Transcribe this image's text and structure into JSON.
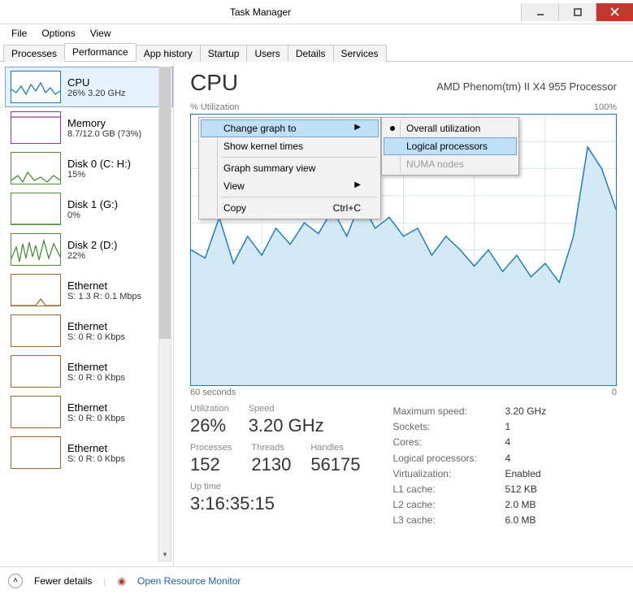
{
  "window": {
    "title": "Task Manager"
  },
  "menu": {
    "file": "File",
    "options": "Options",
    "view": "View"
  },
  "tabs": {
    "items": [
      "Processes",
      "Performance",
      "App history",
      "Startup",
      "Users",
      "Details",
      "Services"
    ],
    "active_index": 1
  },
  "sidebar": {
    "items": [
      {
        "name": "CPU",
        "sub": "26%  3.20 GHz",
        "color": "#1a7ac0"
      },
      {
        "name": "Memory",
        "sub": "8.7/12.0 GB (73%)",
        "color": "#8e3a8e"
      },
      {
        "name": "Disk 0 (C: H:)",
        "sub": "15%",
        "color": "#4e8b3a"
      },
      {
        "name": "Disk 1 (G:)",
        "sub": "0%",
        "color": "#4e8b3a"
      },
      {
        "name": "Disk 2 (D:)",
        "sub": "22%",
        "color": "#4e8b3a"
      },
      {
        "name": "Ethernet",
        "sub": "S: 1.3  R: 0.1 Mbps",
        "color": "#9c6a2e"
      },
      {
        "name": "Ethernet",
        "sub": "S: 0  R: 0 Kbps",
        "color": "#9c6a2e"
      },
      {
        "name": "Ethernet",
        "sub": "S: 0  R: 0 Kbps",
        "color": "#9c6a2e"
      },
      {
        "name": "Ethernet",
        "sub": "S: 0  R: 0 Kbps",
        "color": "#9c6a2e"
      },
      {
        "name": "Ethernet",
        "sub": "S: 0  R: 0 Kbps",
        "color": "#9c6a2e"
      }
    ],
    "selected_index": 0
  },
  "main": {
    "heading": "CPU",
    "model": "AMD Phenom(tm) II X4 955 Processor",
    "axis_top_left": "% Utilization",
    "axis_top_right": "100%",
    "axis_bottom_left": "60 seconds",
    "axis_bottom_right": "0"
  },
  "stats_left": {
    "utilization_lbl": "Utilization",
    "utilization_val": "26%",
    "speed_lbl": "Speed",
    "speed_val": "3.20 GHz",
    "processes_lbl": "Processes",
    "processes_val": "152",
    "threads_lbl": "Threads",
    "threads_val": "2130",
    "handles_lbl": "Handles",
    "handles_val": "56175",
    "uptime_lbl": "Up time",
    "uptime_val": "3:16:35:15"
  },
  "stats_right": {
    "max_speed_k": "Maximum speed:",
    "max_speed_v": "3.20 GHz",
    "sockets_k": "Sockets:",
    "sockets_v": "1",
    "cores_k": "Cores:",
    "cores_v": "4",
    "logical_k": "Logical processors:",
    "logical_v": "4",
    "virt_k": "Virtualization:",
    "virt_v": "Enabled",
    "l1_k": "L1 cache:",
    "l1_v": "512 KB",
    "l2_k": "L2 cache:",
    "l2_v": "2.0 MB",
    "l3_k": "L3 cache:",
    "l3_v": "6.0 MB"
  },
  "footer": {
    "fewer": "Fewer details",
    "resmon": "Open Resource Monitor"
  },
  "context_menu": {
    "change_graph": "Change graph to",
    "kernel": "Show kernel times",
    "summary": "Graph summary view",
    "view": "View",
    "copy": "Copy",
    "copy_shortcut": "Ctrl+C"
  },
  "submenu": {
    "overall": "Overall utilization",
    "logical": "Logical processors",
    "numa": "NUMA nodes"
  },
  "chart_data": {
    "type": "line",
    "title": "% Utilization",
    "xlabel": "seconds ago",
    "ylabel": "% Utilization",
    "ylim": [
      0,
      100
    ],
    "xlim": [
      60,
      0
    ],
    "x": [
      60,
      58,
      56,
      54,
      52,
      50,
      48,
      46,
      44,
      42,
      40,
      38,
      36,
      34,
      32,
      30,
      28,
      26,
      24,
      22,
      20,
      18,
      16,
      14,
      12,
      10,
      8,
      6,
      4,
      2,
      0
    ],
    "values": [
      50,
      47,
      62,
      45,
      55,
      48,
      58,
      52,
      60,
      56,
      65,
      55,
      68,
      58,
      62,
      55,
      58,
      48,
      55,
      50,
      44,
      50,
      42,
      48,
      40,
      45,
      38,
      55,
      88,
      80,
      65
    ]
  }
}
